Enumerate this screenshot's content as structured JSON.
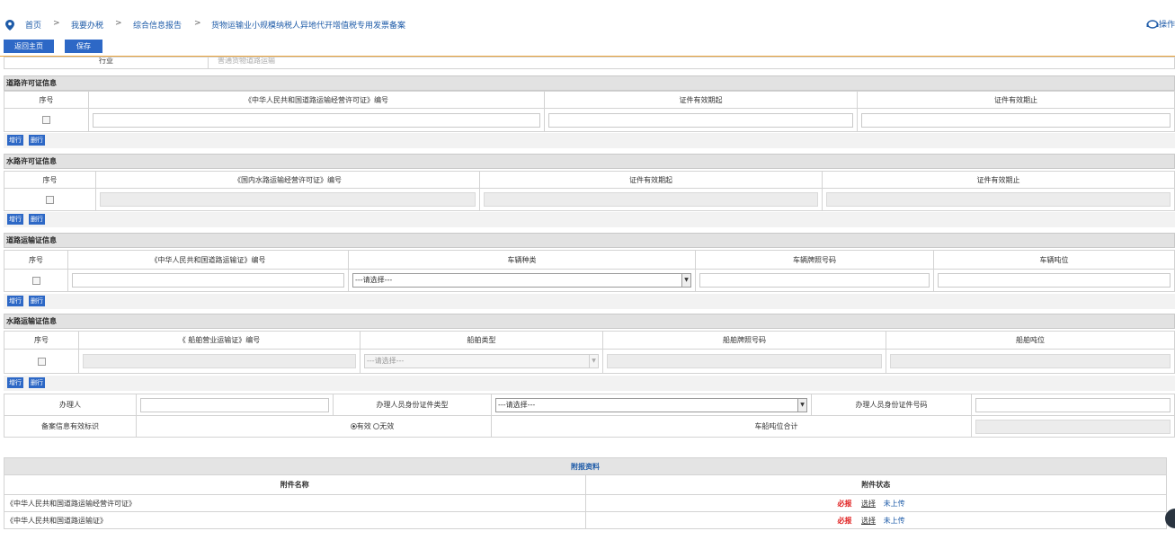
{
  "breadcrumb": [
    "首页",
    "我要办税",
    "综合信息报告",
    "货物运输业小规模纳税人异地代开增值税专用发票备案"
  ],
  "breadcrumb_sep": ">",
  "help_label": "操作",
  "top_buttons": {
    "home": "返回主页",
    "save": "保存"
  },
  "industry": {
    "label": "行业",
    "value": "普通货物道路运输"
  },
  "buttons": {
    "add_row": "增行",
    "delete_row": "删行"
  },
  "road_permit": {
    "title": "道路许可证信息",
    "headers": [
      "序号",
      "《中华人民共和国道路运输经营许可证》编号",
      "证件有效期起",
      "证件有效期止"
    ]
  },
  "water_permit": {
    "title": "水路许可证信息",
    "headers": [
      "序号",
      "《国内水路运输经营许可证》编号",
      "证件有效期起",
      "证件有效期止"
    ]
  },
  "road_transport": {
    "title": "道路运输证信息",
    "headers": [
      "序号",
      "《中华人民共和国道路运输证》编号",
      "车辆种类",
      "车辆牌照号码",
      "车辆吨位"
    ],
    "select_placeholder": "---请选择---"
  },
  "water_transport": {
    "title": "水路运输证信息",
    "headers": [
      "序号",
      "《 船舶营业运输证》编号",
      "船舶类型",
      "船舶牌照号码",
      "船舶吨位"
    ],
    "select_placeholder": "---请选择---"
  },
  "handler": {
    "name_label": "办理人",
    "id_type_label": "办理人员身份证件类型",
    "id_type_placeholder": "---请选择---",
    "id_number_label": "办理人员身份证件号码",
    "valid_label": "备案信息有效标识",
    "valid_option": "有效",
    "invalid_option": "无效",
    "tonnage_label": "车船吨位合计"
  },
  "attachments": {
    "title": "附报资料",
    "col_name": "附件名称",
    "col_status": "附件状态",
    "rows": [
      {
        "name": "《中华人民共和国道路运输经营许可证》",
        "required": "必报",
        "select": "选择",
        "status": "未上传"
      },
      {
        "name": "《中华人民共和国道路运输证》",
        "required": "必报",
        "select": "选择",
        "status": "未上传"
      }
    ]
  }
}
